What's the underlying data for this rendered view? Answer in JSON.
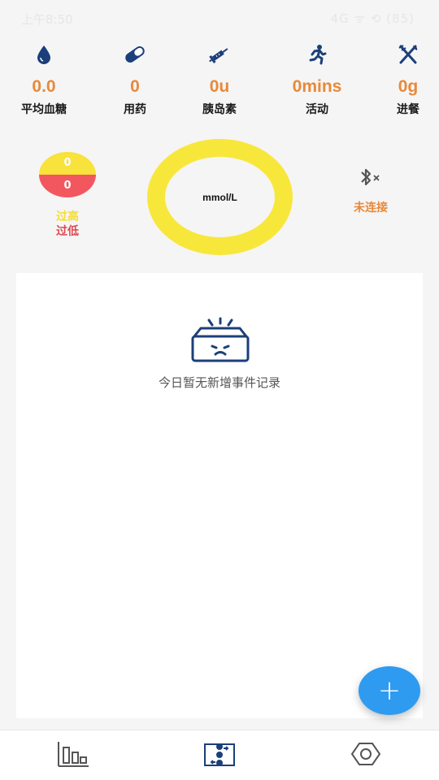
{
  "status_bar": {
    "time": "上午8:50",
    "right": "4G  ᯤ  ⟲  (85)"
  },
  "stats": [
    {
      "icon": "drop-icon",
      "value": "0.0",
      "label": "平均血糖"
    },
    {
      "icon": "pill-icon",
      "value": "0",
      "label": "用药"
    },
    {
      "icon": "syringe-icon",
      "value": "0u",
      "label": "胰岛素"
    },
    {
      "icon": "running-icon",
      "value": "0mins",
      "label": "活动"
    },
    {
      "icon": "utensils-icon",
      "value": "0g",
      "label": "进餐"
    }
  ],
  "range": {
    "high_count": "0",
    "low_count": "0",
    "high_label": "过高",
    "low_label": "过低"
  },
  "glucose": {
    "unit": "mmol/L"
  },
  "device": {
    "status": "未连接"
  },
  "events": {
    "empty_text": "今日暂无新增事件记录"
  },
  "fab_label": "+",
  "colors": {
    "accent_orange": "#e8893a",
    "ring_yellow": "#f8e73b",
    "low_red": "#f2575f",
    "fab_blue": "#2e9bf0",
    "icon_navy": "#1b3f7a"
  },
  "nav": [
    {
      "icon": "chart-icon"
    },
    {
      "icon": "records-icon"
    },
    {
      "icon": "settings-icon"
    }
  ]
}
